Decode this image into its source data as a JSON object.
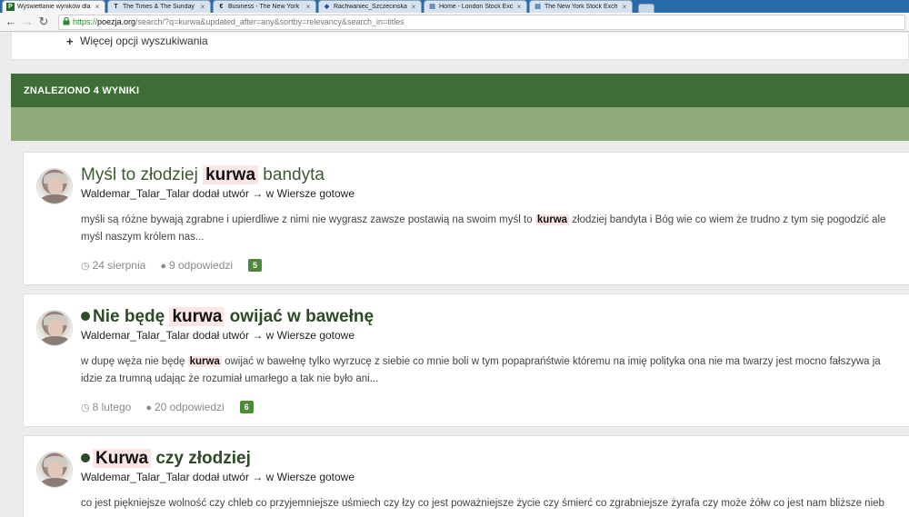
{
  "browser": {
    "tabs": [
      {
        "favicon": "P",
        "favicon_bg": "#1f6b2a",
        "title": "Wyświetlanie wyników dla",
        "active": true
      },
      {
        "favicon": "T",
        "favicon_bg": "#ffffff",
        "title": "The Times & The Sunday",
        "active": false
      },
      {
        "favicon": "€",
        "favicon_bg": "#ffffff",
        "title": "Business - The New York",
        "active": false
      },
      {
        "favicon": "◆",
        "favicon_bg": "#ffffff",
        "title": "Rachwaniec_Szczecinska",
        "active": false
      },
      {
        "favicon": "▤",
        "favicon_bg": "#ffffff",
        "title": "Home - London Stock Exc",
        "active": false
      },
      {
        "favicon": "▤",
        "favicon_bg": "#ffffff",
        "title": "The New York Stock Exch",
        "active": false
      }
    ],
    "close_glyph": "×",
    "url_scheme": "https://",
    "url_host": "poezja.org",
    "url_path": "/search/?q=kurwa&updated_after=any&sortby=relevancy&search_in=titles"
  },
  "search": {
    "more_options_label": "Więcej opcji wyszukiwania",
    "results_count_label": "ZNALEZIONO 4 WYNIKI"
  },
  "results": [
    {
      "title_before": "Myśl to złodziej ",
      "title_highlight": "kurwa",
      "title_after": " bandyta",
      "meta": "Waldemar_Talar_Talar dodał utwór → w Wiersze gotowe",
      "excerpt_line1_before": "myśli są różne bywają zgrabne i upierdliwe z nimi nie wygrasz zawsze postawią na swoim myśl to ",
      "excerpt_line1_highlight": "kurwa",
      "excerpt_line1_after": " złodziej bandyta i Bóg wie co wiem że trudno z tym się pogodzić ale",
      "excerpt_line2": "myśl naszym królem nas...",
      "date": "24 sierpnia",
      "replies": "9 odpowiedzi",
      "badge": "5"
    },
    {
      "title_before": "Nie będę ",
      "title_highlight": "kurwa",
      "title_after": " owijać w bawełnę",
      "meta": "Waldemar_Talar_Talar dodał utwór → w Wiersze gotowe",
      "excerpt_line1_before": "w dupę węża nie będę ",
      "excerpt_line1_highlight": "kurwa",
      "excerpt_line1_after": " owijać w bawełnę tylko wyrzucę z siebie co mnie boli w tym popaprańśtwie któremu na imię polityka ona nie ma twarzy jest mocno fałszywa ja",
      "excerpt_line2": "idzie za trumną udając że rozumiał umarłego a tak nie było ani...",
      "date": "8 lutego",
      "replies": "20 odpowiedzi",
      "badge": "6"
    },
    {
      "title_before": "",
      "title_highlight": "Kurwa",
      "title_after": " czy złodziej",
      "meta": "Waldemar_Talar_Talar dodał utwór → w Wiersze gotowe",
      "excerpt_line1_before": "co jest piękniejsze wolność czy chleb co przyjemniejsze uśmiech czy łzy co jest poważniejsze życie czy śmierć co zgrabniejsze żyrafa czy może żółw co jest nam bliższe nieb",
      "excerpt_line1_highlight": "",
      "excerpt_line1_after": "",
      "excerpt_line2": "",
      "date": "",
      "replies": "",
      "badge": ""
    }
  ],
  "icons": {
    "back": "←",
    "forward": "→",
    "reload": "↻",
    "lock": "🔒",
    "plus": "+",
    "clock": "◷",
    "comment": "💬"
  },
  "colors": {
    "header_green": "#3e6e35",
    "band_green": "#90ab7a",
    "badge_green": "#4d8a3d",
    "highlight_bg": "#fbe6e6"
  }
}
